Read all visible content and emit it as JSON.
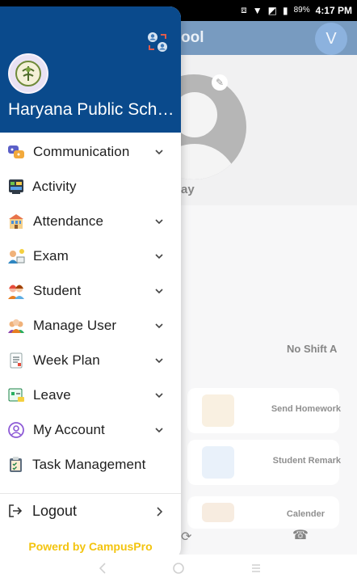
{
  "status_bar": {
    "battery_pct": "89%",
    "time": "4:17 PM"
  },
  "background": {
    "appbar_title_fragment": "ool",
    "avatar_letter": "V",
    "day_fragment": "ay",
    "no_shift_text": "No Shift A",
    "cards": [
      {
        "label": "Send Homework"
      },
      {
        "label": "Student Remark"
      },
      {
        "label": "Calender"
      }
    ]
  },
  "drawer": {
    "school_name": "Haryana Public School",
    "items": [
      {
        "label": "Communication",
        "icon": "communication-icon",
        "expandable": true
      },
      {
        "label": "Activity",
        "icon": "activity-icon",
        "expandable": false
      },
      {
        "label": "Attendance",
        "icon": "attendance-icon",
        "expandable": true
      },
      {
        "label": "Exam",
        "icon": "exam-icon",
        "expandable": true
      },
      {
        "label": "Student",
        "icon": "student-icon",
        "expandable": true
      },
      {
        "label": "Manage User",
        "icon": "manage-user-icon",
        "expandable": true
      },
      {
        "label": "Week Plan",
        "icon": "week-plan-icon",
        "expandable": true
      },
      {
        "label": "Leave",
        "icon": "leave-icon",
        "expandable": true
      },
      {
        "label": "My Account",
        "icon": "my-account-icon",
        "expandable": true
      },
      {
        "label": "Task Management",
        "icon": "task-management-icon",
        "expandable": false
      }
    ],
    "logout_label": "Logout",
    "powered_by": "Powerd by CampusPro"
  },
  "colors": {
    "header_blue": "#0a4a8c",
    "powered_yellow": "#f3c40f",
    "avatar_blue": "#2f74c4"
  }
}
